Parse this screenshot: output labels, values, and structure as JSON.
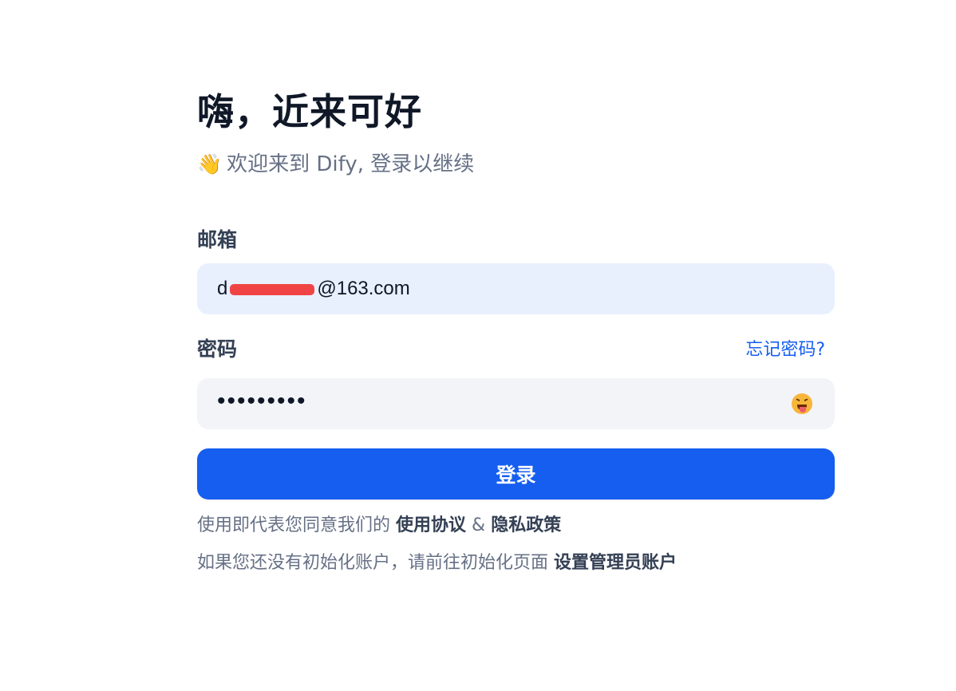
{
  "header": {
    "title": "嗨，近来可好",
    "subtitle_emoji": "👋",
    "subtitle": "欢迎来到 Dify, 登录以继续"
  },
  "form": {
    "email_label": "邮箱",
    "email_value": "du          9@163.com",
    "email_visible_start": "d",
    "email_visible_end": "@163.com",
    "password_label": "密码",
    "forgot_link": "忘记密码?",
    "password_mask": "•••••••••",
    "toggle_icon": "tongue-out-face-icon",
    "login_button": "登录"
  },
  "footer": {
    "terms_prefix": "使用即代表您同意我们的",
    "terms_link": "使用协议",
    "terms_and": "&",
    "privacy_link": "隐私政策",
    "setup_prefix": "如果您还没有初始化账户，请前往初始化页面",
    "setup_link": "设置管理员账户"
  },
  "colors": {
    "accent": "#155eef",
    "email_bg": "#e8f0fe",
    "password_bg": "#f2f4f7",
    "muted_text": "#667085",
    "redaction": "#f04444"
  }
}
